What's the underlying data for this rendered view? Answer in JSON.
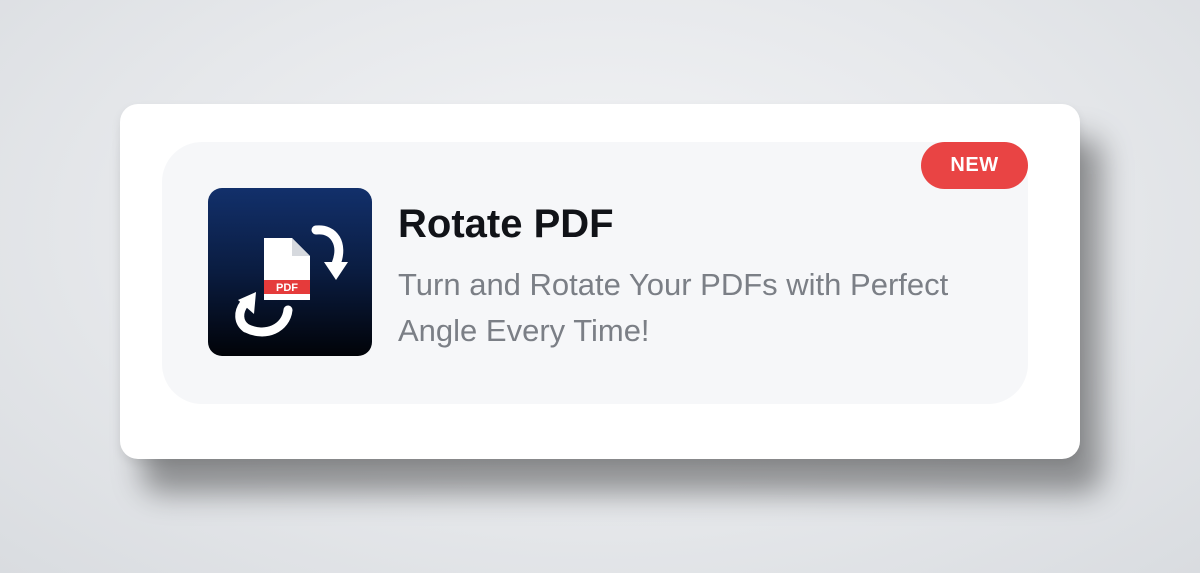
{
  "tool": {
    "badge": "NEW",
    "title": "Rotate PDF",
    "description": "Turn and Rotate Your PDFs with Perfect Angle Every Time!",
    "icon_label": "PDF",
    "icon": "rotate-pdf-icon"
  },
  "colors": {
    "badge": "#e94444",
    "icon_top": "#12306b",
    "icon_bottom": "#010308",
    "title": "#111318",
    "description": "#7b7f86"
  }
}
